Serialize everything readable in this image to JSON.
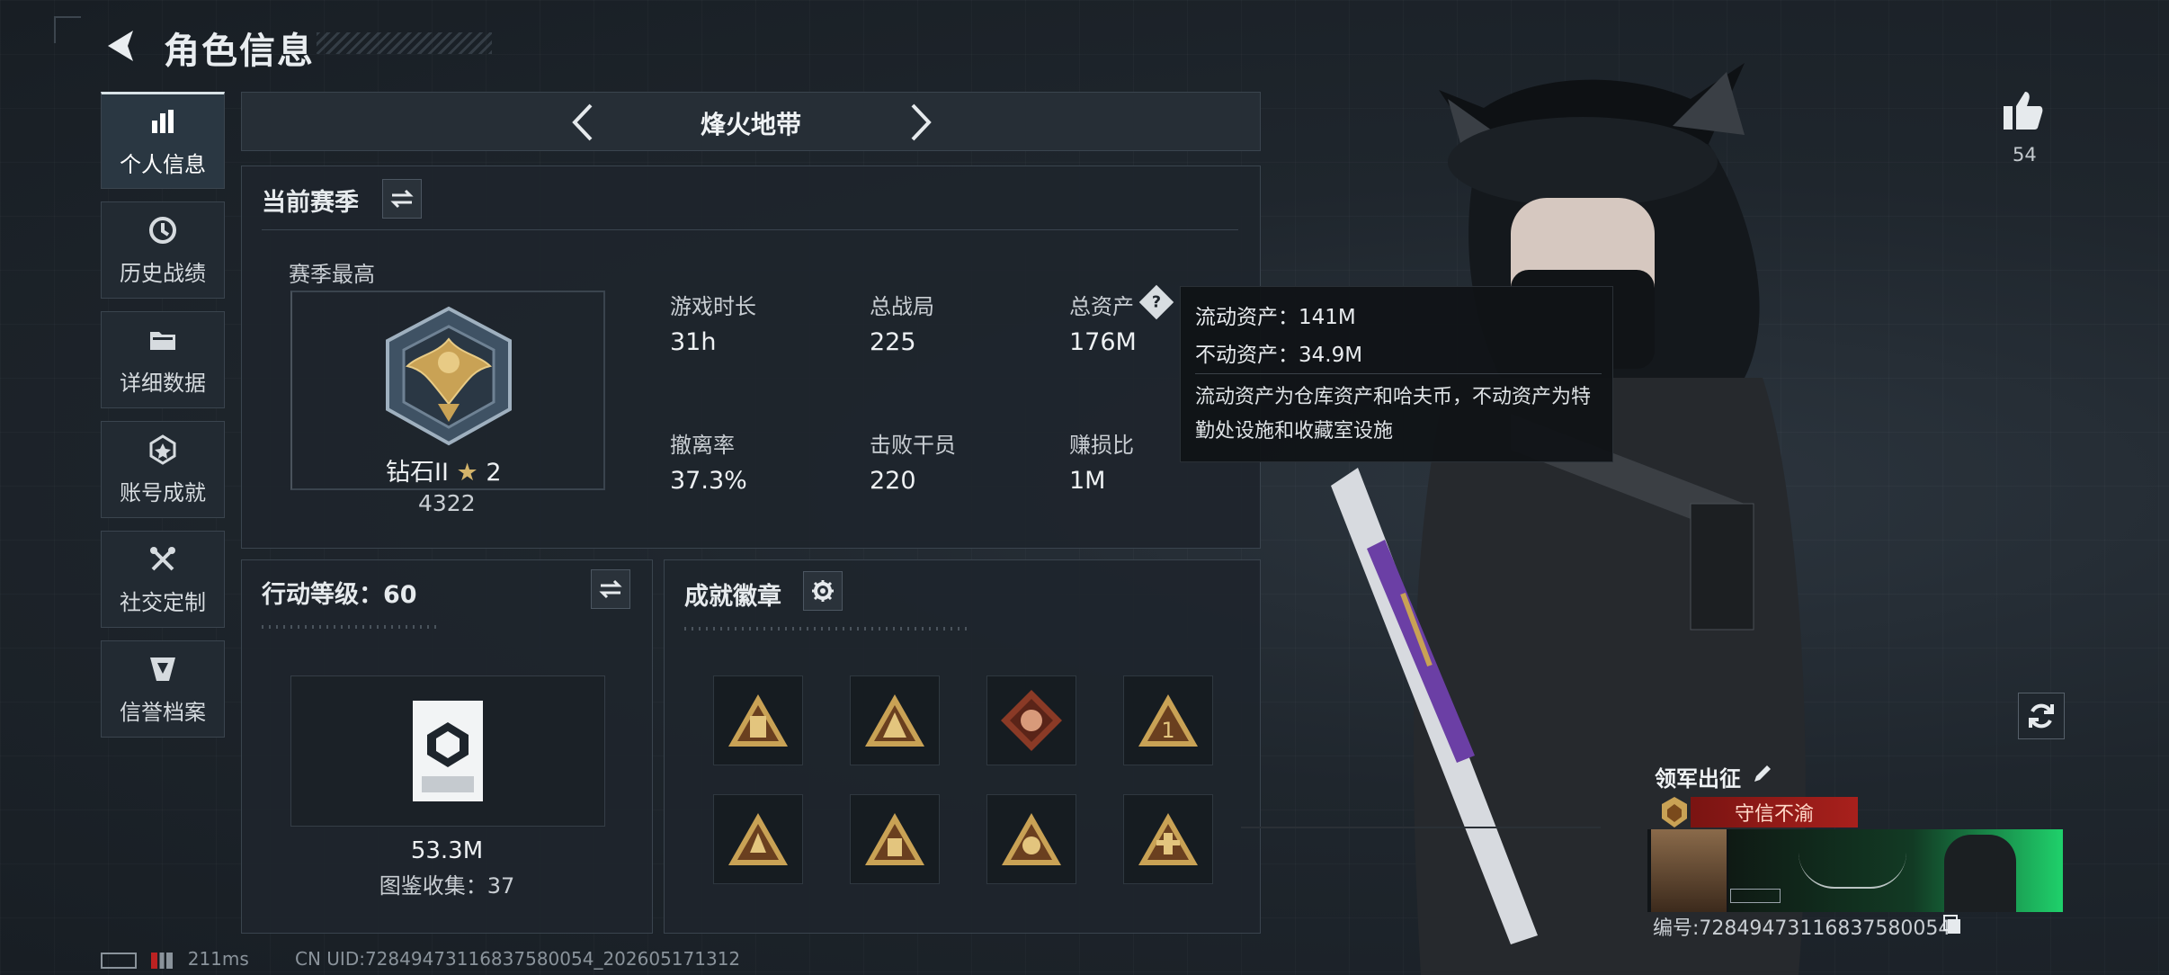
{
  "header": {
    "title": "角色信息"
  },
  "sidebar": {
    "items": [
      {
        "label": "个人信息",
        "icon": "bar-chart-icon"
      },
      {
        "label": "历史战绩",
        "icon": "history-icon"
      },
      {
        "label": "详细数据",
        "icon": "folder-icon"
      },
      {
        "label": "账号成就",
        "icon": "achievement-icon"
      },
      {
        "label": "社交定制",
        "icon": "tools-icon"
      },
      {
        "label": "信誉档案",
        "icon": "credit-icon"
      }
    ]
  },
  "mode": {
    "name": "烽火地带"
  },
  "season": {
    "title": "当前赛季",
    "best_label": "赛季最高",
    "rank_name": "钻石II",
    "rank_stars": "2",
    "rank_score": "4322",
    "stats": [
      {
        "label": "游戏时长",
        "value": "31h"
      },
      {
        "label": "总战局",
        "value": "225"
      },
      {
        "label": "总资产",
        "value": "176M"
      },
      {
        "label": "撤离率",
        "value": "37.3%"
      },
      {
        "label": "击败干员",
        "value": "220"
      },
      {
        "label": "赚损比",
        "value": "1M"
      }
    ]
  },
  "tooltip": {
    "liquid": "流动资产：141M",
    "fixed": "不动资产：34.9M",
    "desc": "流动资产为仓库资产和哈夫币，不动资产为特勤处设施和收藏室设施"
  },
  "action": {
    "title": "行动等级：60",
    "value": "53.3M",
    "collection": "图鉴收集：37"
  },
  "achievements": {
    "title": "成就徽章",
    "count": 8
  },
  "likes": {
    "count": "54"
  },
  "leader": {
    "title": "领军出征",
    "tag": "守信不渝",
    "id": "编号:72849473116837580054"
  },
  "status": {
    "ping": "211ms",
    "uid": "CN UID:72849473116837580054_202605171312"
  },
  "colors": {
    "accent_red": "#a8201c",
    "gold": "#c9a255",
    "panel": "#1e252c"
  }
}
